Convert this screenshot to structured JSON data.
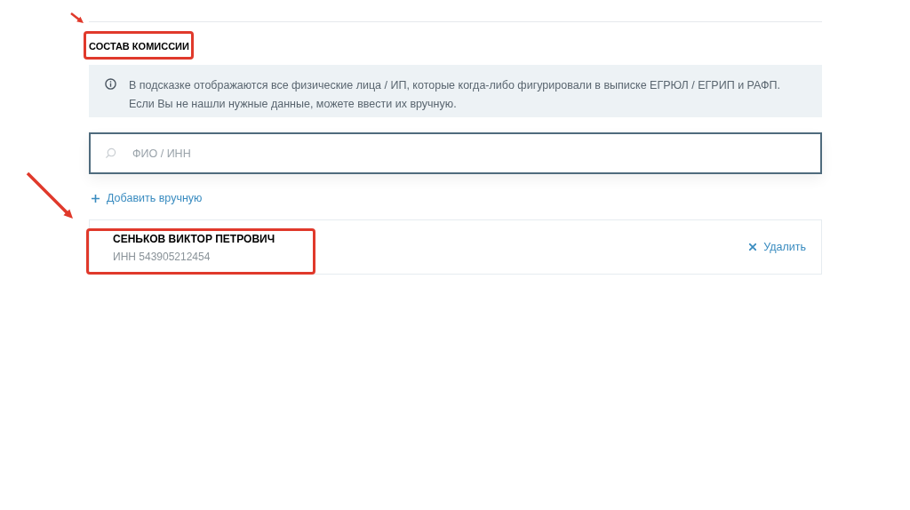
{
  "section": {
    "title": "СОСТАВ КОМИССИИ"
  },
  "info": {
    "lines": [
      "В подсказке отображаются все физические лица / ИП, которые когда-либо фигурировали в выписке ЕГРЮЛ / ЕГРИП и РАФП.",
      "Если Вы не нашли нужные данные, можете ввести их вручную."
    ]
  },
  "search": {
    "placeholder": "ФИО / ИНН"
  },
  "add_link": {
    "label": "Добавить вручную"
  },
  "members": [
    {
      "name": "СЕНЬКОВ ВИКТОР ПЕТРОВИЧ",
      "inn": "ИНН 543905212454",
      "remove": "Удалить"
    }
  ]
}
